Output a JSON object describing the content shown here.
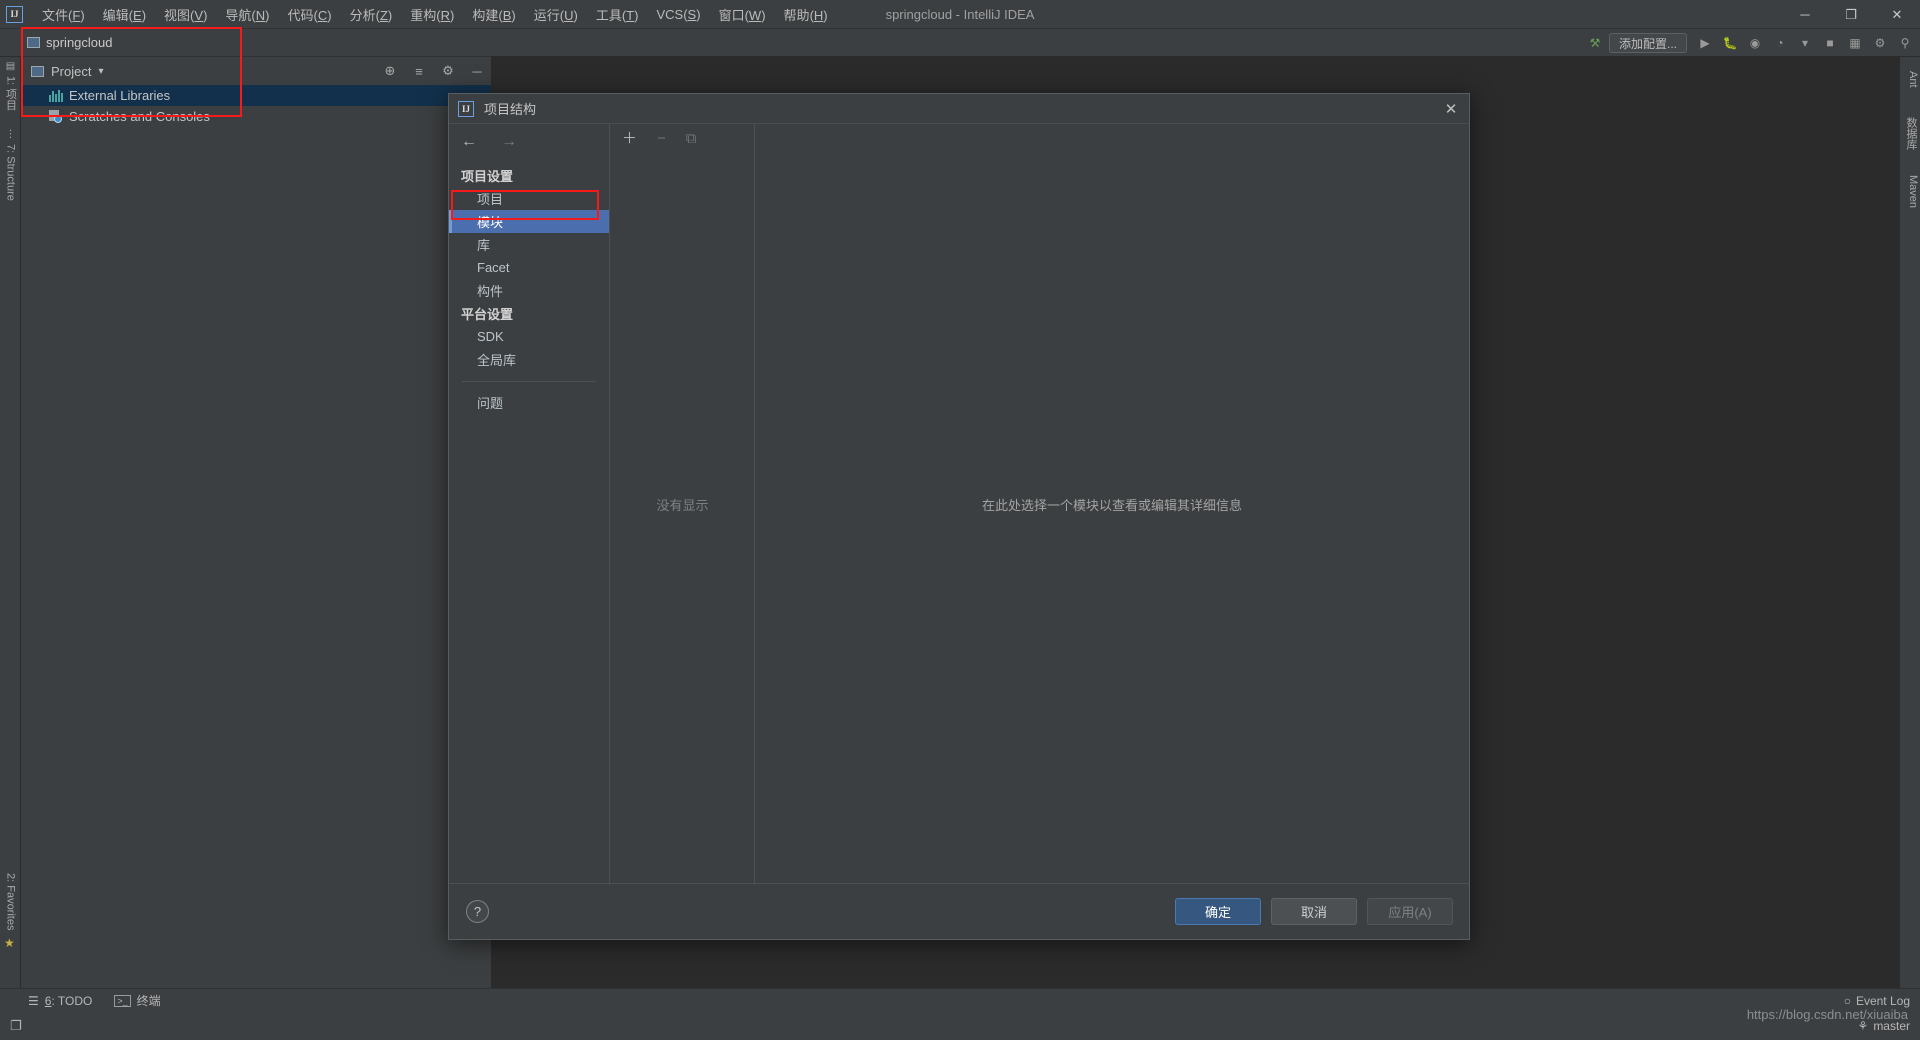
{
  "window": {
    "title": "springcloud - IntelliJ IDEA",
    "minimize": "─",
    "maximize": "❐",
    "close": "✕",
    "logo": "IJ"
  },
  "menubar": {
    "items": [
      {
        "label": "文件",
        "mnemonic": "F"
      },
      {
        "label": "编辑",
        "mnemonic": "E"
      },
      {
        "label": "视图",
        "mnemonic": "V"
      },
      {
        "label": "导航",
        "mnemonic": "N"
      },
      {
        "label": "代码",
        "mnemonic": "C"
      },
      {
        "label": "分析",
        "mnemonic": "Z"
      },
      {
        "label": "重构",
        "mnemonic": "R"
      },
      {
        "label": "构建",
        "mnemonic": "B"
      },
      {
        "label": "运行",
        "mnemonic": "U"
      },
      {
        "label": "工具",
        "mnemonic": "T"
      },
      {
        "label": "VCS",
        "mnemonic": "S"
      },
      {
        "label": "窗口",
        "mnemonic": "W"
      },
      {
        "label": "帮助",
        "mnemonic": "H"
      }
    ]
  },
  "toolbar": {
    "hammer_icon": "⚒",
    "config_selector": "添加配置...",
    "run_icon": "▶",
    "debug_icon": "ὁE",
    "stop_icon": "■",
    "coverage_icon": "◉",
    "profile_icon": "◔",
    "dropdown_icon": "▾",
    "search_icon": "⚲",
    "layout_icon": "▦",
    "settings_icon": "⚙"
  },
  "left_tool_strip": {
    "tabs": [
      {
        "label": "1: 项目",
        "icon": "grid-icon"
      },
      {
        "label": "7: Structure",
        "icon": "structure-icon"
      },
      {
        "label": "2: Favorites",
        "icon": "star-icon"
      }
    ]
  },
  "right_tool_strip": {
    "tabs": [
      {
        "label": "Ant"
      },
      {
        "label": "数据库"
      },
      {
        "label": "Maven"
      }
    ]
  },
  "project_panel": {
    "project_name": "springcloud",
    "view_selector": "Project",
    "dropdown_caret": "▾",
    "toolbar_icons": [
      {
        "name": "locate-icon",
        "glyph": "⊕"
      },
      {
        "name": "collapse-all-icon",
        "glyph": "≡"
      },
      {
        "name": "settings-icon",
        "glyph": "⚙"
      },
      {
        "name": "hide-icon",
        "glyph": "─"
      }
    ],
    "tree": [
      {
        "label": "External Libraries",
        "icon": "libraries-icon",
        "selected": true
      },
      {
        "label": "Scratches and Consoles",
        "icon": "scratches-icon",
        "selected": false
      }
    ]
  },
  "dialog": {
    "title": "项目结构",
    "logo": "IJ",
    "close_icon": "✕",
    "nav": {
      "back_icon": "←",
      "forward_icon": "→",
      "groups": [
        {
          "header": "项目设置",
          "items": [
            {
              "label": "项目",
              "selected": false
            },
            {
              "label": "模块",
              "selected": true
            },
            {
              "label": "库",
              "selected": false
            },
            {
              "label": "Facet",
              "selected": false
            },
            {
              "label": "构件",
              "selected": false
            }
          ]
        },
        {
          "header": "平台设置",
          "items": [
            {
              "label": "SDK",
              "selected": false
            },
            {
              "label": "全局库",
              "selected": false
            }
          ]
        }
      ],
      "extra_items": [
        {
          "label": "问题",
          "selected": false
        }
      ]
    },
    "middle_panel": {
      "add_icon": "＋",
      "remove_icon": "−",
      "copy_icon": "⧉",
      "empty_text": "没有显示"
    },
    "main_panel": {
      "message": "在此处选择一个模块以查看或编辑其详细信息"
    },
    "footer": {
      "help_icon": "?",
      "buttons": [
        {
          "label": "确定",
          "style": "primary"
        },
        {
          "label": "取消",
          "style": "normal"
        },
        {
          "label": "应用(A)",
          "style": "disabled"
        }
      ]
    }
  },
  "status_bar": {
    "todo": {
      "label": "6: TODO",
      "mnemonic": "6",
      "icon": "todo-icon"
    },
    "terminal": {
      "label": "终端",
      "icon": "terminal-icon"
    },
    "event_log": {
      "label": "Event Log",
      "icon": "bell-icon"
    },
    "branch": {
      "label": "master",
      "icon": "branch-icon"
    },
    "watermark": "https://blog.csdn.net/xiuaiba"
  },
  "annotations": {
    "color": "#f61b1b",
    "boxes": [
      {
        "name": "project-tree-highlight"
      },
      {
        "name": "modules-nav-item-highlight"
      }
    ]
  }
}
